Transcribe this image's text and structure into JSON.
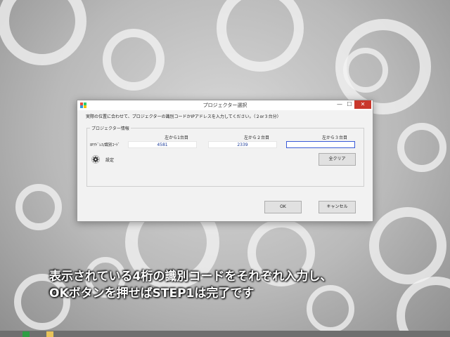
{
  "dialog": {
    "title": "プロジェクター選択",
    "window_controls": {
      "minimize": "—",
      "maximize": "☐",
      "close": "✕"
    },
    "instruction": "実際の位置に合わせて、プロジェクターの識別コードかIPアドレスを入力してください。（２or３台分）",
    "group_label": "プロジェクター情報",
    "columns": [
      "左から1台目",
      "左から２台目",
      "左から３台目"
    ],
    "row_label": "IPｱﾄﾞﾚｽ/識別ｺｰﾄﾞ",
    "fields": [
      "4581",
      "2339",
      ""
    ],
    "settings_label": "設定",
    "clear_all_label": "全クリア",
    "ok_label": "OK",
    "cancel_label": "キャンセル"
  },
  "caption": {
    "line1": "表示されている4桁の識別コードをそれぞれ入力し、",
    "line2": "OKボタンを押せばSTEP1は完了です"
  },
  "colors": {
    "close_button": "#c9372b",
    "active_field_border": "#3a5bd8",
    "field_text": "#1e3e9b"
  }
}
